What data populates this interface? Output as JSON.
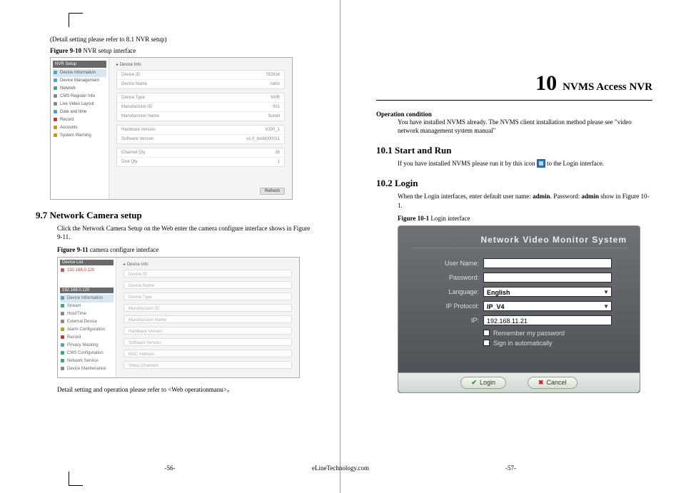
{
  "left": {
    "detail_ref": "(Detail setting please refer to 8.1 NVR setup)",
    "fig910_label": "Figure 9-10",
    "fig910_caption": " NVR setup interface",
    "fig910": {
      "side_header": "NVR Setup",
      "side_items": [
        {
          "label": "Device Information",
          "sel": true,
          "c": "#4aa3d6"
        },
        {
          "label": "Device Management",
          "c": "#4aa3d6"
        },
        {
          "label": "Network",
          "c": "#3a7"
        },
        {
          "label": "CMS Register Info",
          "c": "#888"
        },
        {
          "label": "Live Video Layout",
          "c": "#888"
        },
        {
          "label": "Date and time",
          "c": "#4aa3d6"
        },
        {
          "label": "Record",
          "c": "#c33"
        },
        {
          "label": "Accounts",
          "c": "#c90"
        },
        {
          "label": "System Warning",
          "c": "#c90"
        }
      ],
      "crumb": "Device Info",
      "rows1": [
        [
          "Device ID",
          "782834"
        ],
        [
          "Device Name",
          "robin"
        ]
      ],
      "rows2": [
        [
          "Device Type",
          "NVR"
        ],
        [
          "Manufacturer ID",
          "001"
        ],
        [
          "Manufacturer Name",
          "Sunell"
        ]
      ],
      "rows3": [
        [
          "Hardware Version",
          "V200_1"
        ],
        [
          "Software Version",
          "v1.0_build000011"
        ]
      ],
      "rows4": [
        [
          "Channel Qty",
          "16"
        ],
        [
          "Disk Qty",
          "1"
        ]
      ],
      "refresh": "Refresh"
    },
    "h97": "9.7 Network Camera setup",
    "h97_body": "Click the Network Camera Setup on the Web enter the camera configure interface shows in Figure 9-11.",
    "fig911_label": "Figure 9-11",
    "fig911_caption": " camera configure interface",
    "fig911": {
      "side_header": "Device List",
      "ip_item": "192.168.0.120",
      "sub_header": "192.168.0.120",
      "side_items": [
        {
          "label": "Device Information",
          "sel": true,
          "c": "#4aa3d6"
        },
        {
          "label": "Stream",
          "c": "#3a7"
        },
        {
          "label": "Host/Time",
          "c": "#888"
        },
        {
          "label": "External Device",
          "c": "#888"
        },
        {
          "label": "Alarm Configuration",
          "c": "#c90"
        },
        {
          "label": "Record",
          "c": "#c33"
        },
        {
          "label": "Privacy Masking",
          "c": "#4aa3d6"
        },
        {
          "label": "CMS Configuration",
          "c": "#3a7"
        },
        {
          "label": "Network Service",
          "c": "#3a7"
        },
        {
          "label": "Device Maintenance",
          "c": "#888"
        }
      ],
      "crumb": "Device Info",
      "lines": [
        "Device ID",
        "Device Name",
        "Device Type",
        "Manufacturer ID",
        "Manufacturer Name",
        "Hardware Version",
        "Software Version",
        "MAC Address",
        "Video Channels"
      ]
    },
    "detail_note": "Detail setting and operation please refer to <Web operationmanu>。",
    "pagenum": "-56-"
  },
  "right": {
    "chapter_num": "10",
    "chapter_title": "NVMS Access NVR",
    "opcond_h": "Operation condition",
    "opcond_body": "You have installed NVMS already. The NVMS client installation method please see \"video network management system manual\"",
    "h101": "10.1 Start and Run",
    "h101_a": "If you have installed NVMS please run it by this icon",
    "h101_b": " to the Login interface.",
    "h102": "10.2 Login",
    "h102_body_a": "When the Login interfaces, enter default user name: ",
    "h102_body_b": ". Password: ",
    "h102_body_c": " show in Figure 10-1.",
    "admin": "admin",
    "fig101_label": "Figure 10-1",
    "fig101_caption": " Login interface",
    "fig101": {
      "title": "Network Video Monitor System",
      "user_lbl": "User Name:",
      "pass_lbl": "Password:",
      "lang_lbl": "Language:",
      "lang_val": "English",
      "proto_lbl": "IP Protocol:",
      "proto_val": "IP_V4",
      "ip_lbl": "IP:",
      "ip_val": "192.168.11.21",
      "remember": "Remember my password",
      "auto": "Sign in automatically",
      "login": "Login",
      "cancel": "Cancel"
    },
    "pagenum": "-57-"
  },
  "footer": "eLineTechnology.com"
}
